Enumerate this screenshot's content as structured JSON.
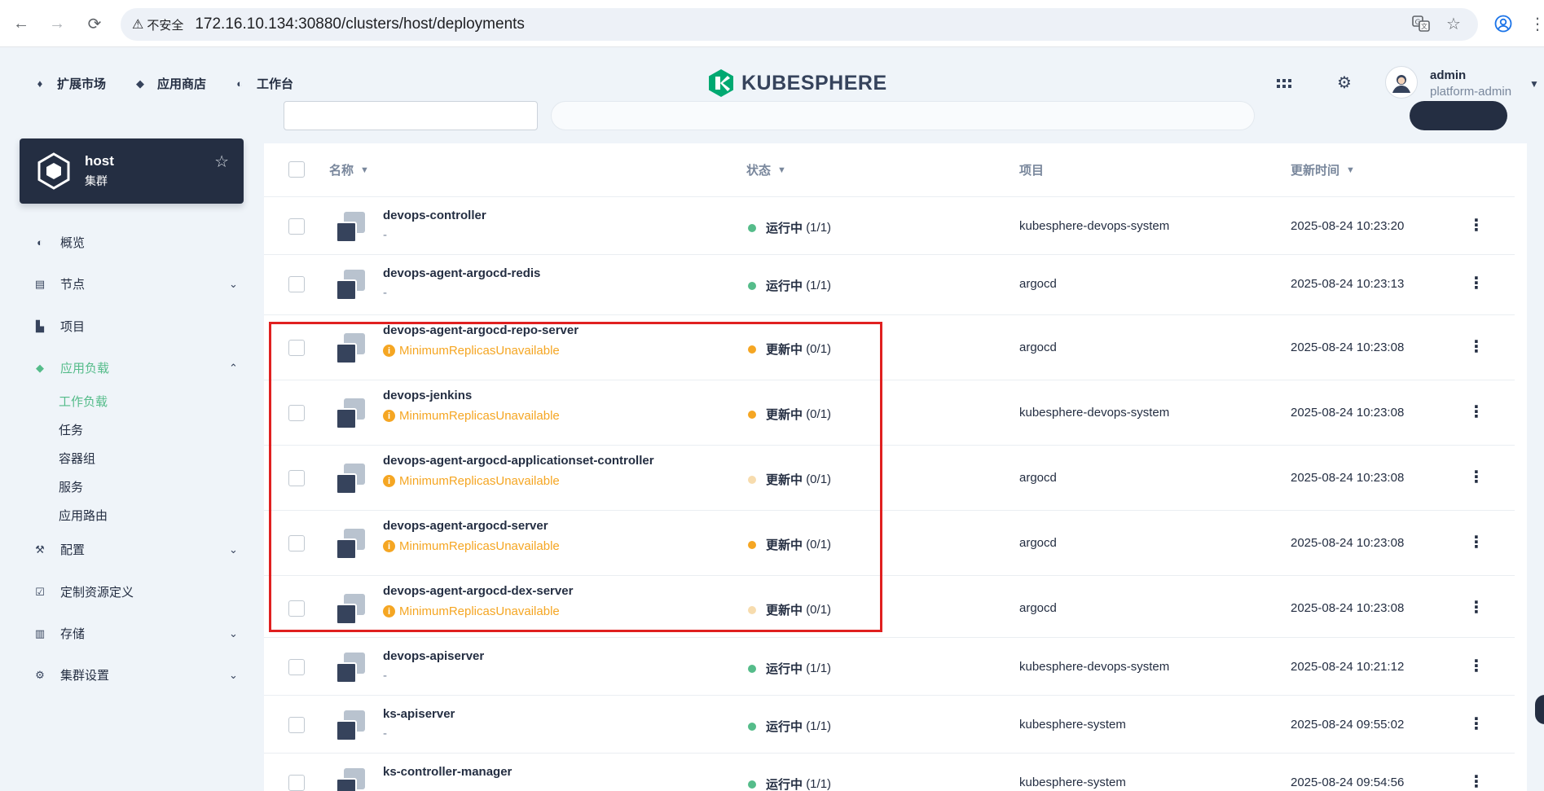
{
  "browser": {
    "insecure_label": "不安全",
    "url": "172.16.10.134:30880/clusters/host/deployments"
  },
  "header": {
    "links": [
      {
        "label": "扩展市场",
        "icon": "extension-icon"
      },
      {
        "label": "应用商店",
        "icon": "layers-icon"
      },
      {
        "label": "工作台",
        "icon": "dashboard-icon"
      }
    ],
    "logo_text": "KUBESPHERE",
    "user": {
      "name": "admin",
      "role": "platform-admin"
    }
  },
  "sidebar": {
    "cluster": {
      "name": "host",
      "type": "集群"
    },
    "items": [
      {
        "label": "概览"
      },
      {
        "label": "节点"
      },
      {
        "label": "项目"
      },
      {
        "label": "应用负载"
      },
      {
        "label": "配置"
      },
      {
        "label": "定制资源定义"
      },
      {
        "label": "存储"
      },
      {
        "label": "集群设置"
      }
    ],
    "sub_items": [
      {
        "label": "工作负载"
      },
      {
        "label": "任务"
      },
      {
        "label": "容器组"
      },
      {
        "label": "服务"
      },
      {
        "label": "应用路由"
      }
    ]
  },
  "table": {
    "columns": {
      "name": "名称",
      "status": "状态",
      "project": "项目",
      "updated": "更新时间"
    },
    "rows": [
      {
        "name": "devops-controller",
        "sub": "-",
        "status": "运行中",
        "count": "(1/1)",
        "project": "kubesphere-devops-system",
        "time": "2025-08-24 10:23:20"
      },
      {
        "name": "devops-agent-argocd-redis",
        "sub": "-",
        "status": "运行中",
        "count": "(1/1)",
        "project": "argocd",
        "time": "2025-08-24 10:23:13"
      },
      {
        "name": "devops-agent-argocd-repo-server",
        "sub": "MinimumReplicasUnavailable",
        "status": "更新中",
        "count": "(0/1)",
        "project": "argocd",
        "time": "2025-08-24 10:23:08"
      },
      {
        "name": "devops-jenkins",
        "sub": "MinimumReplicasUnavailable",
        "status": "更新中",
        "count": "(0/1)",
        "project": "kubesphere-devops-system",
        "time": "2025-08-24 10:23:08"
      },
      {
        "name": "devops-agent-argocd-applicationset-controller",
        "sub": "MinimumReplicasUnavailable",
        "status": "更新中",
        "count": "(0/1)",
        "project": "argocd",
        "time": "2025-08-24 10:23:08"
      },
      {
        "name": "devops-agent-argocd-server",
        "sub": "MinimumReplicasUnavailable",
        "status": "更新中",
        "count": "(0/1)",
        "project": "argocd",
        "time": "2025-08-24 10:23:08"
      },
      {
        "name": "devops-agent-argocd-dex-server",
        "sub": "MinimumReplicasUnavailable",
        "status": "更新中",
        "count": "(0/1)",
        "project": "argocd",
        "time": "2025-08-24 10:23:08"
      },
      {
        "name": "devops-apiserver",
        "sub": "-",
        "status": "运行中",
        "count": "(1/1)",
        "project": "kubesphere-devops-system",
        "time": "2025-08-24 10:21:12"
      },
      {
        "name": "ks-apiserver",
        "sub": "-",
        "status": "运行中",
        "count": "(1/1)",
        "project": "kubesphere-system",
        "time": "2025-08-24 09:55:02"
      },
      {
        "name": "ks-controller-manager",
        "sub": "-",
        "status": "运行中",
        "count": "(1/1)",
        "project": "kubesphere-system",
        "time": "2025-08-24 09:54:56"
      }
    ]
  },
  "colors": {
    "running": "#55bc8a",
    "updating": "#f5a623",
    "accent": "#55bc8a",
    "highlight": "#e02020"
  }
}
